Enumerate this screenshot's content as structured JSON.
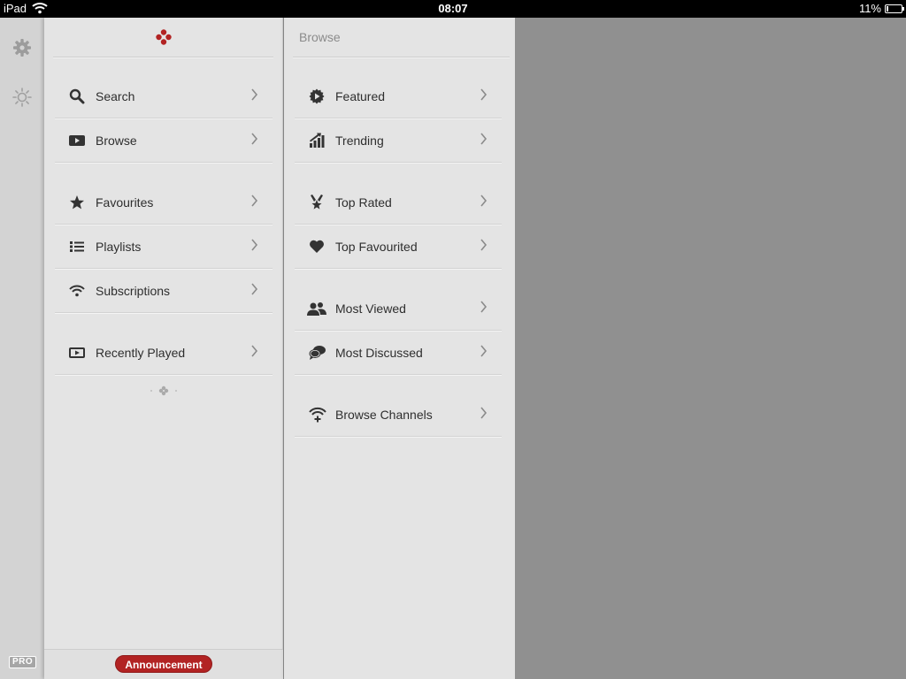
{
  "status_bar": {
    "carrier": "iPad",
    "time": "08:07",
    "battery": "11%",
    "battery_level": 0.11
  },
  "rail": {
    "pro_badge": "PRO"
  },
  "left_menu": {
    "items": [
      {
        "label": "Search",
        "icon": "search-icon"
      },
      {
        "label": "Browse",
        "icon": "play-box-icon"
      },
      {
        "label": "Favourites",
        "icon": "star-icon"
      },
      {
        "label": "Playlists",
        "icon": "list-icon"
      },
      {
        "label": "Subscriptions",
        "icon": "wifi-icon"
      },
      {
        "label": "Recently Played",
        "icon": "recent-play-icon"
      }
    ],
    "footer_button": "Announcement"
  },
  "browse_panel": {
    "title": "Browse",
    "items": [
      {
        "label": "Featured",
        "icon": "featured-badge-icon"
      },
      {
        "label": "Trending",
        "icon": "trending-bars-icon"
      },
      {
        "label": "Top Rated",
        "icon": "award-icon"
      },
      {
        "label": "Top Favourited",
        "icon": "heart-icon"
      },
      {
        "label": "Most Viewed",
        "icon": "users-icon"
      },
      {
        "label": "Most Discussed",
        "icon": "chat-bubbles-icon"
      },
      {
        "label": "Browse Channels",
        "icon": "channel-add-icon"
      }
    ]
  },
  "colors": {
    "accent": "#b22323",
    "panel": "#e4e4e4",
    "backdrop": "#909090"
  }
}
